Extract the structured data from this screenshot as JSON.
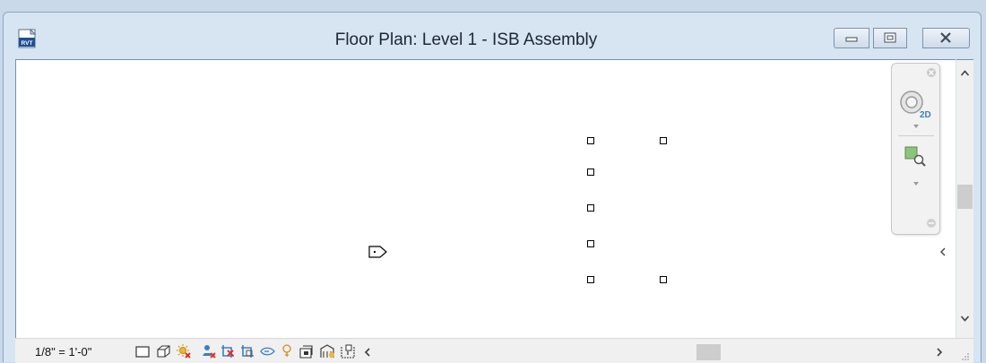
{
  "window": {
    "title": "Floor Plan: Level 1 - ISB Assembly",
    "app_icon_label": "RVT"
  },
  "status_bar": {
    "scale": "1/8\" = 1'-0\"",
    "view_controls": [
      "detail-level-icon",
      "visual-style-icon",
      "sun-path-icon",
      "shadows-icon",
      "crop-view-icon",
      "show-crop-region-icon",
      "temporary-hide-isolate-icon",
      "reveal-hidden-elements-icon",
      "lock-3d-view-icon",
      "analytical-model-icon",
      "highlight-displacement-icon"
    ]
  },
  "colors": {
    "frame": "#d7e4f2",
    "canvas": "#ffffff",
    "scroll_thumb": "#cdcdcd",
    "navigation_blue": "#3a7fc4",
    "navigation_green": "#6aa84f"
  }
}
